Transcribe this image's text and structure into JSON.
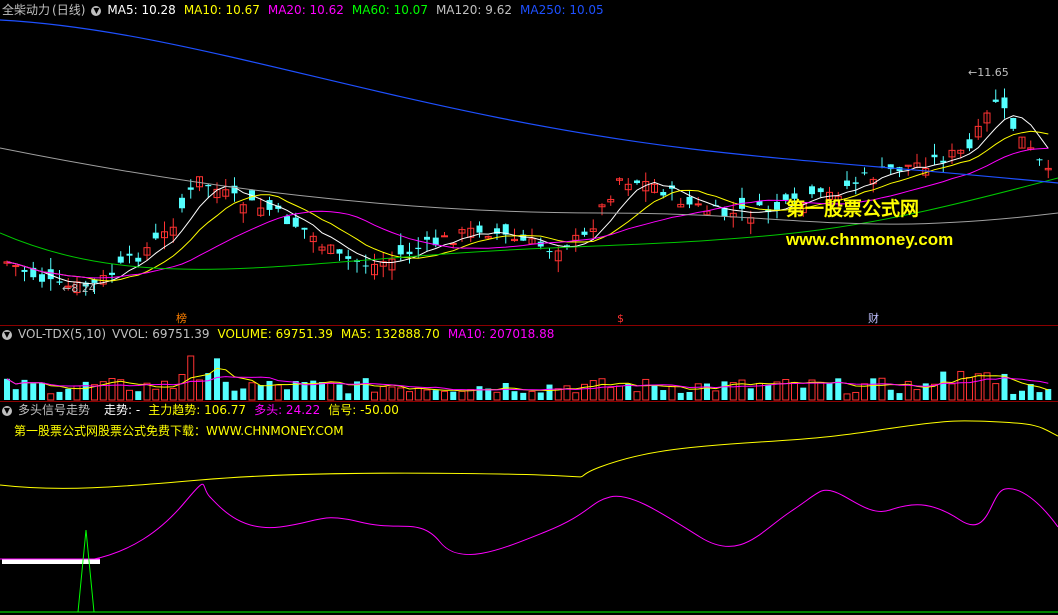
{
  "kline": {
    "stock_name": "全柴动力",
    "period": "(日线)",
    "ma": [
      {
        "label": "MA5: 10.28",
        "color": "#ffffff"
      },
      {
        "label": "MA10: 10.67",
        "color": "#ffff00"
      },
      {
        "label": "MA20: 10.62",
        "color": "#ff00ff"
      },
      {
        "label": "MA60: 10.07",
        "color": "#00ff00"
      },
      {
        "label": "MA120: 9.62",
        "color": "#c0c0c0"
      },
      {
        "label": "MA250: 10.05",
        "color": "#1e50ff"
      }
    ],
    "high_label": "11.65",
    "low_label": "8.24",
    "tags": [
      "榜",
      "$",
      "财"
    ],
    "watermark_cn": "第一股票公式网",
    "watermark_url": "www.chnmoney.com",
    "price_range": [
      7.9,
      12.2
    ],
    "colors": {
      "up": "#ff3232",
      "down": "#54ffff"
    }
  },
  "volume": {
    "indicator": "VOL-TDX(5,10)",
    "items": [
      {
        "label": "VVOL: 69751.39",
        "color": "#c0c0c0"
      },
      {
        "label": "VOLUME: 69751.39",
        "color": "#ffff00"
      },
      {
        "label": "MA5: 132888.70",
        "color": "#ffff00"
      },
      {
        "label": "MA10: 207018.88",
        "color": "#ff00ff"
      }
    ]
  },
  "signal": {
    "indicator": "多头信号走势",
    "items": [
      {
        "label": "走势: -",
        "color": "#ffffff"
      },
      {
        "label": "主力趋势: 106.77",
        "color": "#ffff00"
      },
      {
        "label": "多头: 24.22",
        "color": "#ff00ff"
      },
      {
        "label": "信号: -50.00",
        "color": "#ffff00"
      }
    ],
    "promo": "第一股票公式网股票公式免费下载：WWW.CHNMONEY.COM"
  }
}
